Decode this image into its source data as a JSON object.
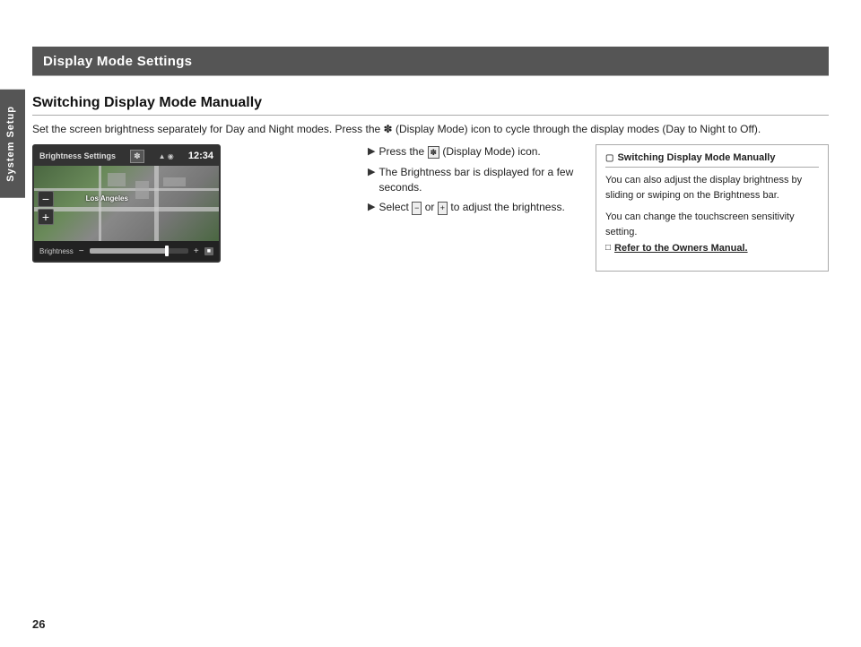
{
  "page": {
    "number": "26",
    "sidebar_tab": "System Setup"
  },
  "header": {
    "title": "Display Mode Settings"
  },
  "section": {
    "title": "Switching Display Mode Manually",
    "intro": "Set the screen brightness separately for Day and Night modes. Press the  (Display Mode) icon to cycle through the display modes (Day to Night to Off)."
  },
  "screen_mockup": {
    "title": "Brightness Settings",
    "time": "12:34",
    "city": "Los Angeles",
    "brightness_label": "Brightness"
  },
  "steps": [
    {
      "arrow": "▶",
      "text": "Press the  (Display Mode) icon."
    },
    {
      "arrow": "▶",
      "text": "The Brightness bar is displayed for a few seconds."
    },
    {
      "arrow": "▶",
      "text": "Select  or  to adjust the brightness."
    }
  ],
  "note": {
    "header": "Switching Display Mode Manually",
    "para1": "You can also adjust the display brightness by sliding or swiping on the Brightness bar.",
    "para2": "You can change the touchscreen sensitivity setting.",
    "refer": "Refer to the Owners Manual."
  }
}
